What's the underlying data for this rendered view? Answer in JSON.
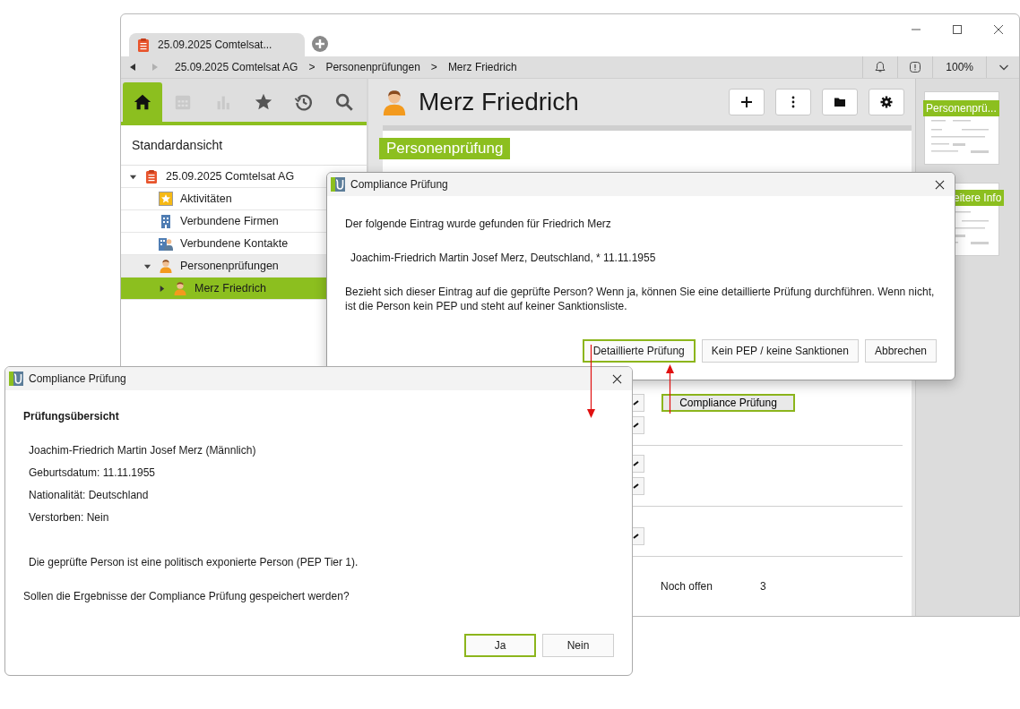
{
  "window": {
    "tab_title": "25.09.2025 Comtelsat..."
  },
  "address_bar": {
    "back_disabled": false,
    "forward_disabled": true,
    "separator": ">",
    "breadcrumb": [
      "25.09.2025 Comtelsat AG",
      "Personenprüfungen",
      "Merz Friedrich"
    ],
    "zoom": "100%"
  },
  "sidebar": {
    "tabs": [
      {
        "kind": "home",
        "selected": true,
        "disabled": false
      },
      {
        "kind": "calendar",
        "selected": false,
        "disabled": true
      },
      {
        "kind": "chart",
        "selected": false,
        "disabled": true
      },
      {
        "kind": "star",
        "selected": false,
        "disabled": false
      },
      {
        "kind": "history",
        "selected": false,
        "disabled": false
      },
      {
        "kind": "search",
        "selected": false,
        "disabled": false
      }
    ],
    "view_title": "Standardansicht",
    "tree": [
      {
        "label": "25.09.2025 Comtelsat AG",
        "kind": "record",
        "expanded": true,
        "selected": false,
        "highlighted": false,
        "children": [
          {
            "label": "Aktivitäten",
            "kind": "activities",
            "selected": false,
            "highlighted": false
          },
          {
            "label": "Verbundene Firmen",
            "kind": "companies",
            "selected": false,
            "highlighted": false
          },
          {
            "label": "Verbundene Kontakte",
            "kind": "contacts",
            "selected": false,
            "highlighted": false
          },
          {
            "label": "Personenprüfungen",
            "kind": "person",
            "expanded": true,
            "selected": false,
            "highlighted": true,
            "children": [
              {
                "label": "Merz Friedrich",
                "kind": "person",
                "expanded": false,
                "selected": true
              }
            ]
          }
        ]
      }
    ]
  },
  "record": {
    "title": "Merz Friedrich",
    "section": "Personenprüfung",
    "groups": [
      {
        "fields": [
          {
            "kind": "dropdown",
            "action": "Compliance Prüfung"
          },
          {
            "kind": "dropdown"
          }
        ]
      },
      {
        "fields": [
          {
            "kind": "dropdown"
          },
          {
            "kind": "dropdown"
          }
        ]
      },
      {
        "fields": [
          {
            "kind": "dropdown"
          }
        ]
      }
    ],
    "status_label": "Noch offen",
    "status_value": "3"
  },
  "thumbnails": [
    {
      "label": "Personenprü..."
    },
    {
      "label": "eitere Info"
    }
  ],
  "dialogs": [
    {
      "title": "Compliance Prüfung",
      "paragraphs": [
        {
          "kind": "text",
          "text": "Der folgende Eintrag wurde gefunden für Friedrich Merz"
        },
        {
          "kind": "finding",
          "text": "Joachim-Friedrich Martin Josef Merz, Deutschland, * 11.11.1955"
        },
        {
          "kind": "text",
          "text": "Bezieht sich dieser Eintrag auf die geprüfte Person? Wenn ja, können Sie eine detaillierte Prüfung durchführen. Wenn nicht, ist die Person kein PEP und steht auf keiner Sanktionsliste."
        }
      ],
      "buttons": [
        {
          "label": "Detaillierte Prüfung",
          "default": true
        },
        {
          "label": "Kein PEP / keine Sanktionen",
          "default": false
        },
        {
          "label": "Abbrechen",
          "default": false
        }
      ]
    },
    {
      "title": "Compliance Prüfung",
      "paragraphs": [
        {
          "kind": "heading",
          "text": "Prüfungsübersicht"
        },
        {
          "kind": "entry",
          "text": "Joachim-Friedrich Martin Josef Merz (Männlich)"
        },
        {
          "kind": "entry",
          "text": "Geburtsdatum: 11.11.1955"
        },
        {
          "kind": "entry",
          "text": "Nationalität: Deutschland"
        },
        {
          "kind": "entry",
          "text": "Verstorben: Nein"
        },
        {
          "kind": "finding",
          "text": "Die geprüfte Person ist eine politisch exponierte Person (PEP Tier 1)."
        },
        {
          "kind": "text",
          "text": "Sollen die Ergebnisse der Compliance Prüfung gespeichert werden?"
        }
      ],
      "buttons": [
        {
          "label": "Ja",
          "default": true
        },
        {
          "label": "Nein",
          "default": false
        }
      ]
    }
  ]
}
